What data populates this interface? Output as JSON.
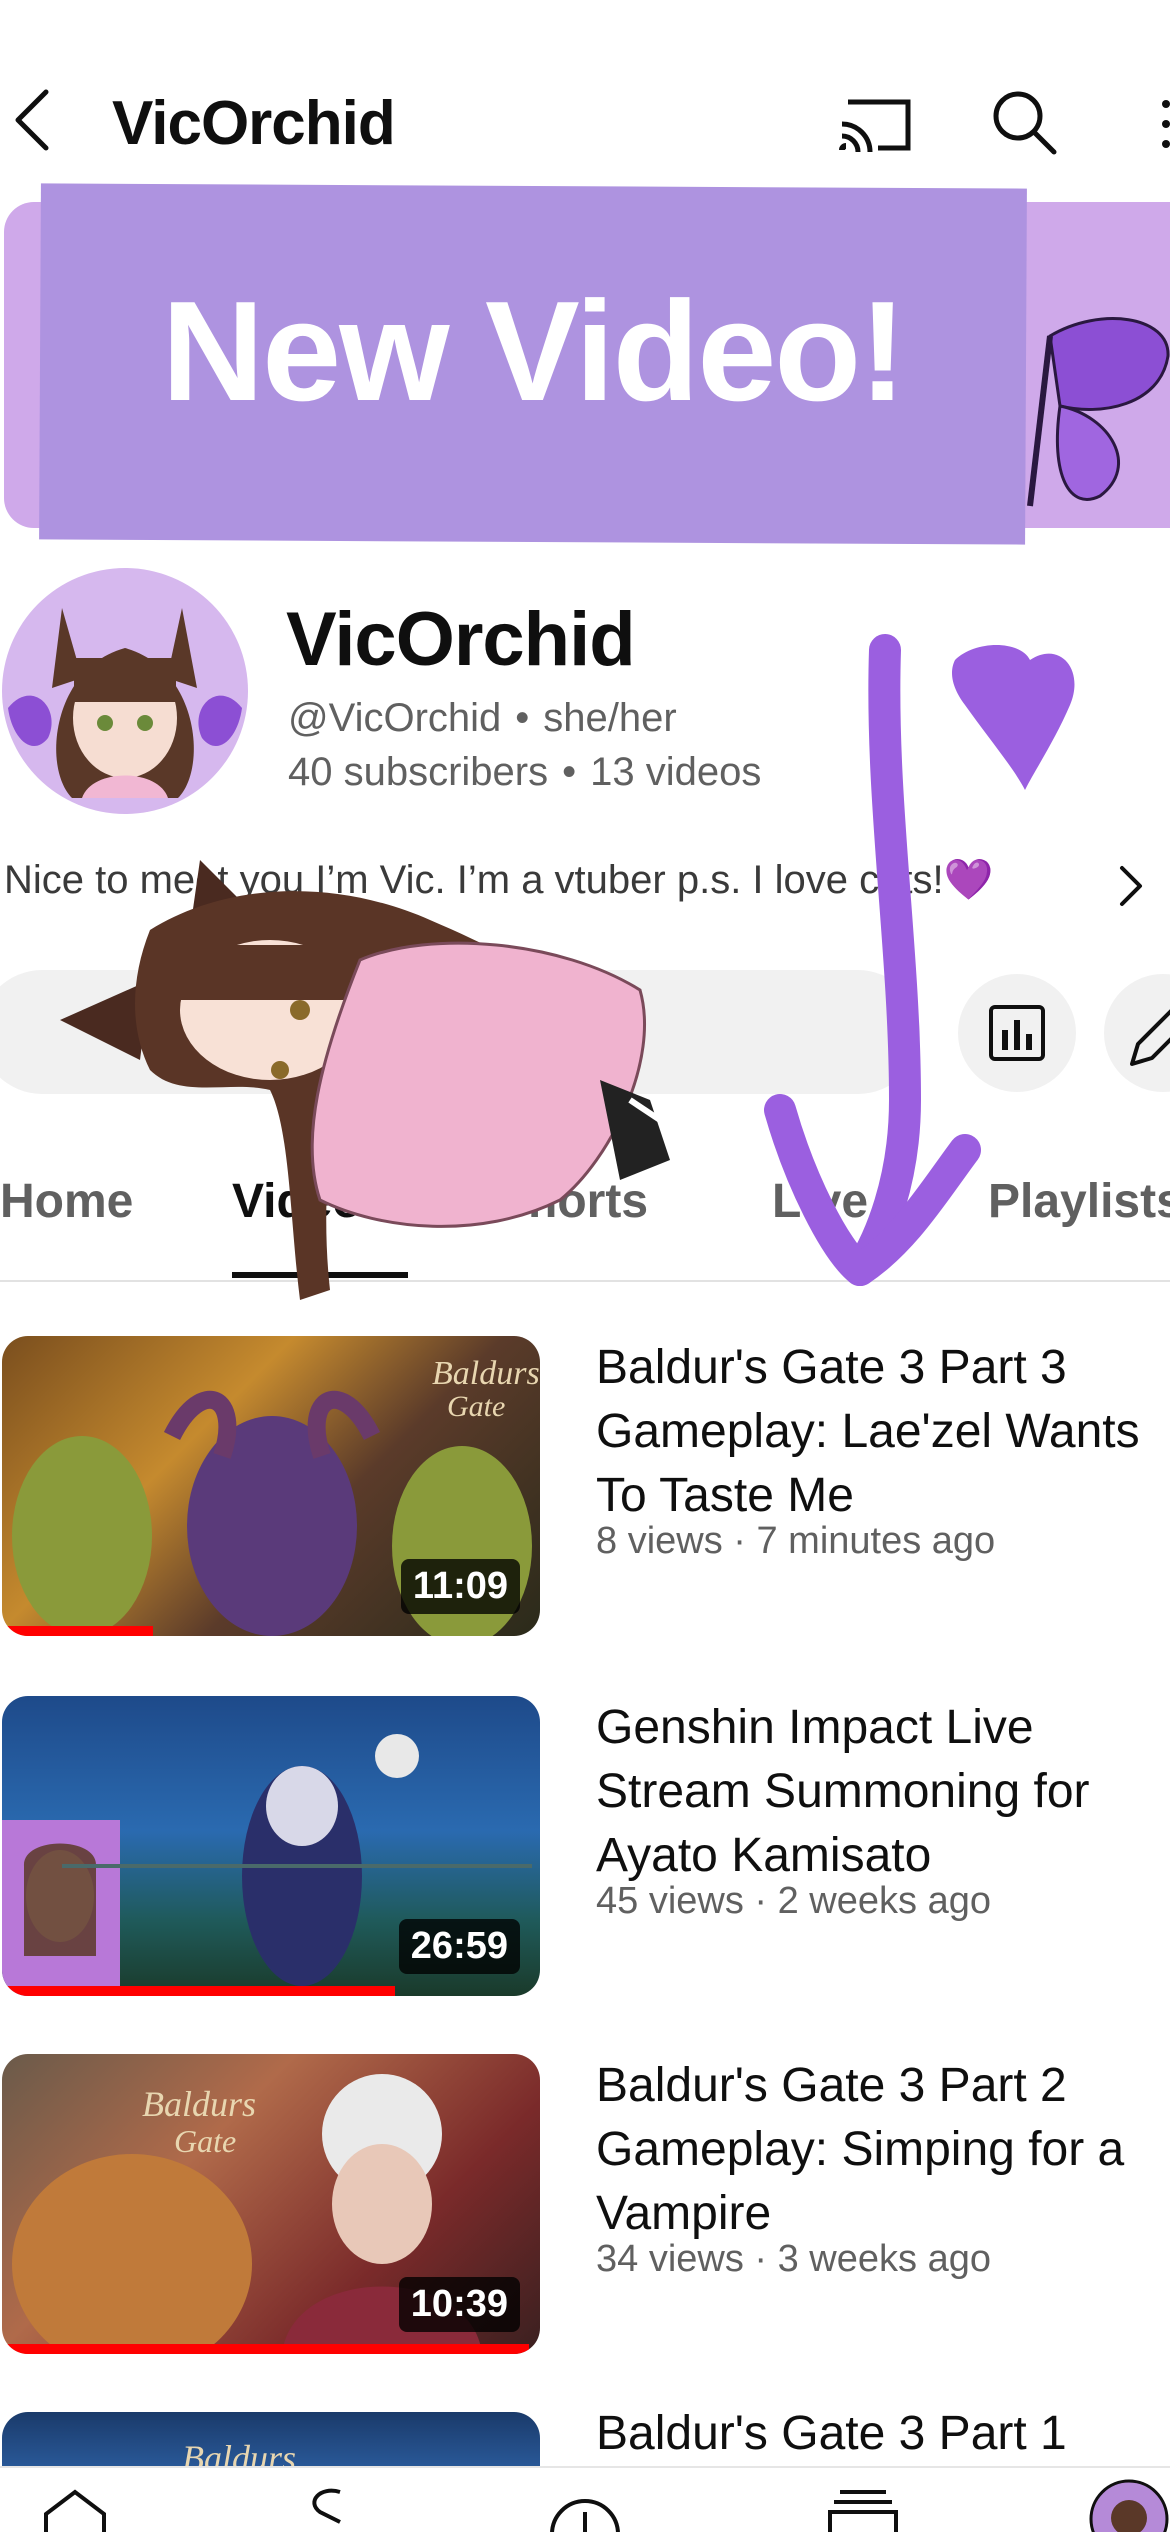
{
  "header": {
    "title": "VicOrchid",
    "back_icon": "chevron-left-icon",
    "cast_icon": "cast-icon",
    "search_icon": "search-icon",
    "more_icon": "more-vertical-icon"
  },
  "banner": {
    "text": "New Video!",
    "colors": {
      "background": "#cfa9ea",
      "card": "#ae93e0"
    }
  },
  "channel": {
    "name": "VicOrchid",
    "handle": "@VicOrchid",
    "pronouns": "she/her",
    "subscribers": "40 subscribers",
    "videos": "13 videos",
    "description": "Nice to meet you I’m Vic. I’m a vtuber p.s. I love cats!💜"
  },
  "actions": {
    "analytics_icon": "bar-chart-icon",
    "edit_icon": "pencil-icon"
  },
  "tabs": [
    {
      "label": "Home"
    },
    {
      "label": "Videos"
    },
    {
      "label": "Shorts"
    },
    {
      "label": "Live"
    },
    {
      "label": "Playlists"
    }
  ],
  "videos": [
    {
      "title": "Baldur's Gate 3 Part 3 Gameplay: Lae'zel Wants To Taste Me",
      "meta": "8 views · 7 minutes ago",
      "duration": "11:09",
      "progress": 0.28
    },
    {
      "title": "Genshin Impact Live Stream Summoning for Ayato Kamisato",
      "meta": "45 views · 2 weeks ago",
      "duration": "26:59",
      "progress": 0.73
    },
    {
      "title": "Baldur's Gate 3 Part 2 Gameplay: Simping for a Vampire",
      "meta": "34 views · 3 weeks ago",
      "duration": "10:39",
      "progress": 0.98
    },
    {
      "title": "Baldur's Gate 3 Part 1",
      "meta": "",
      "duration": "",
      "progress": 0
    }
  ],
  "bottom_nav": {
    "icons": [
      "home-icon",
      "shorts-icon",
      "create-icon",
      "subscriptions-icon",
      "you-avatar-icon"
    ]
  },
  "overlay": {
    "accent_color": "#9b5fe0"
  }
}
